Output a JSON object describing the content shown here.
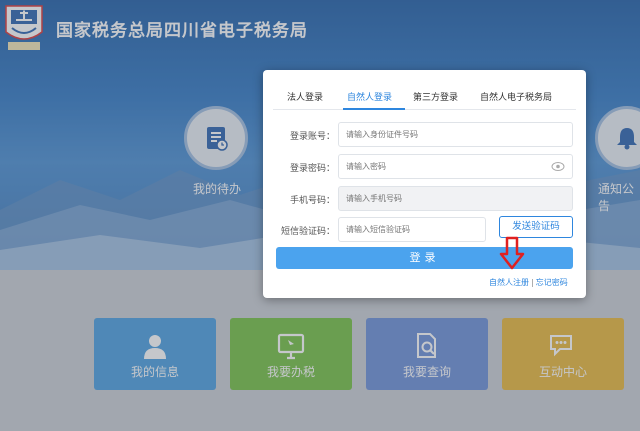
{
  "header": {
    "title": "国家税务总局四川省电子税务局",
    "logo_text": "中国税务"
  },
  "banner": {
    "left_item": {
      "label": "我的待办",
      "icon": "todo-icon"
    },
    "right_item": {
      "label": "通知公告",
      "icon": "bell-icon"
    }
  },
  "tiles": [
    {
      "label": "我的信息",
      "icon": "person-icon",
      "color": "#4a9fe0"
    },
    {
      "label": "我要办税",
      "icon": "monitor-icon",
      "color": "#74c043"
    },
    {
      "label": "我要查询",
      "icon": "document-search-icon",
      "color": "#6a8fd8"
    },
    {
      "label": "互动中心",
      "icon": "chat-icon",
      "color": "#e8b73a"
    }
  ],
  "login": {
    "tabs": [
      "法人登录",
      "自然人登录",
      "第三方登录",
      "自然人电子税务局"
    ],
    "active_tab": "自然人登录",
    "fields": {
      "account": {
        "label": "登录账号：",
        "placeholder": "请输入身份证件号码"
      },
      "password": {
        "label": "登录密码：",
        "placeholder": "请输入密码"
      },
      "phone": {
        "label": "手机号码：",
        "placeholder": "请输入手机号码"
      },
      "sms": {
        "label": "短信验证码：",
        "placeholder": "请输入短信验证码"
      }
    },
    "sms_button": "发送验证码",
    "login_button": "登录",
    "register_link": "自然人注册",
    "forgot_link": "忘记密码"
  },
  "colors": {
    "accent": "#2e86de",
    "login_button": "#4ba3ee",
    "arrow": "#e02020"
  }
}
